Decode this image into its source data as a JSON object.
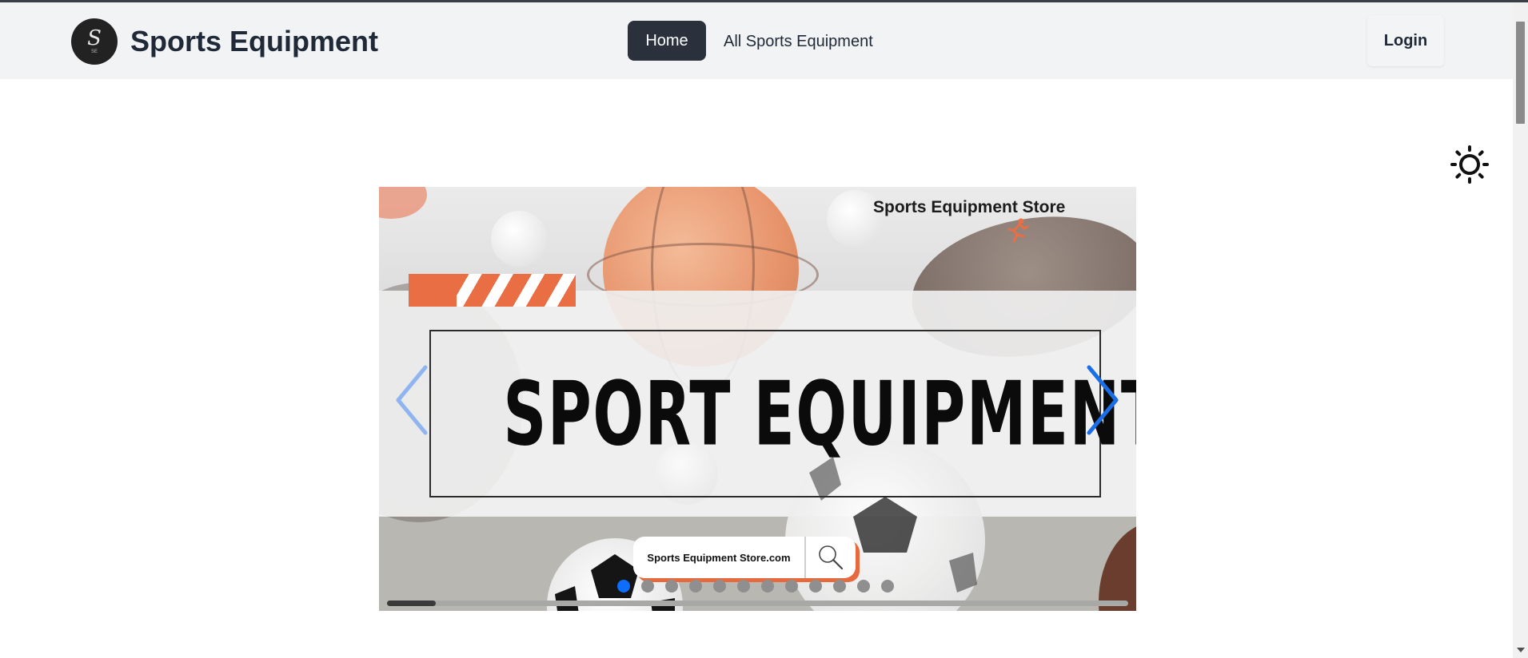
{
  "header": {
    "brand_name": "Sports Equipment",
    "logo_letter": "S",
    "logo_sub": "SE",
    "nav": [
      {
        "label": "Home",
        "active": true
      },
      {
        "label": "All Sports Equipment",
        "active": false
      }
    ],
    "login_label": "Login"
  },
  "theme_toggle_icon": "sun-icon",
  "carousel": {
    "store_name": "Sports Equipment Store",
    "headline": "SPORT EQUIPMENT",
    "search_text": "Sports Equipment Store.com",
    "prev_icon": "chevron-left-icon",
    "next_icon": "chevron-right-icon",
    "slide_count": 12,
    "active_slide": 1,
    "autoplay_progress": 0.066
  },
  "colors": {
    "nav_active_bg": "#2a303c",
    "accent_blue": "#0d6efd",
    "accent_orange": "#e96e44"
  }
}
